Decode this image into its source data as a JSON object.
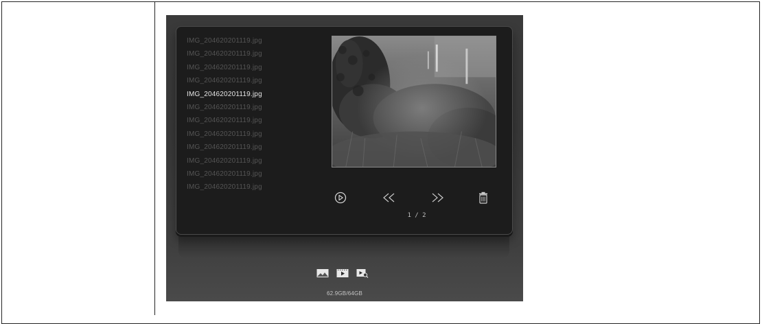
{
  "colors": {
    "background": "#ffffff",
    "screen_bg": "#3a3a3a",
    "panel_bg": "#1c1c1c",
    "file_inactive": "#555555",
    "file_active": "#e6e6e6",
    "icon": "#d0d0d0"
  },
  "file_list": {
    "items": [
      {
        "name": "IMG_204620201119.jpg",
        "active": false
      },
      {
        "name": "IMG_204620201119.jpg",
        "active": false
      },
      {
        "name": "IMG_204620201119.jpg",
        "active": false
      },
      {
        "name": "IMG_204620201119.jpg",
        "active": false
      },
      {
        "name": "IMG_204620201119.jpg",
        "active": true
      },
      {
        "name": "IMG_204620201119.jpg",
        "active": false
      },
      {
        "name": "IMG_204620201119.jpg",
        "active": false
      },
      {
        "name": "IMG_204620201119.jpg",
        "active": false
      },
      {
        "name": "IMG_204620201119.jpg",
        "active": false
      },
      {
        "name": "IMG_204620201119.jpg",
        "active": false
      },
      {
        "name": "IMG_204620201119.jpg",
        "active": false
      },
      {
        "name": "IMG_204620201119.jpg",
        "active": false
      }
    ]
  },
  "controls": {
    "play_icon": "play-circle-icon",
    "prev_icon": "double-chevron-left-icon",
    "next_icon": "double-chevron-right-icon",
    "delete_icon": "trash-icon"
  },
  "pagination": {
    "current": "1",
    "total": "2",
    "text": "1 / 2"
  },
  "modes": {
    "photo_icon": "photo-icon",
    "video_icon": "video-icon",
    "video_search_icon": "video-search-icon"
  },
  "storage": {
    "text": "62.9GB/64GB"
  }
}
